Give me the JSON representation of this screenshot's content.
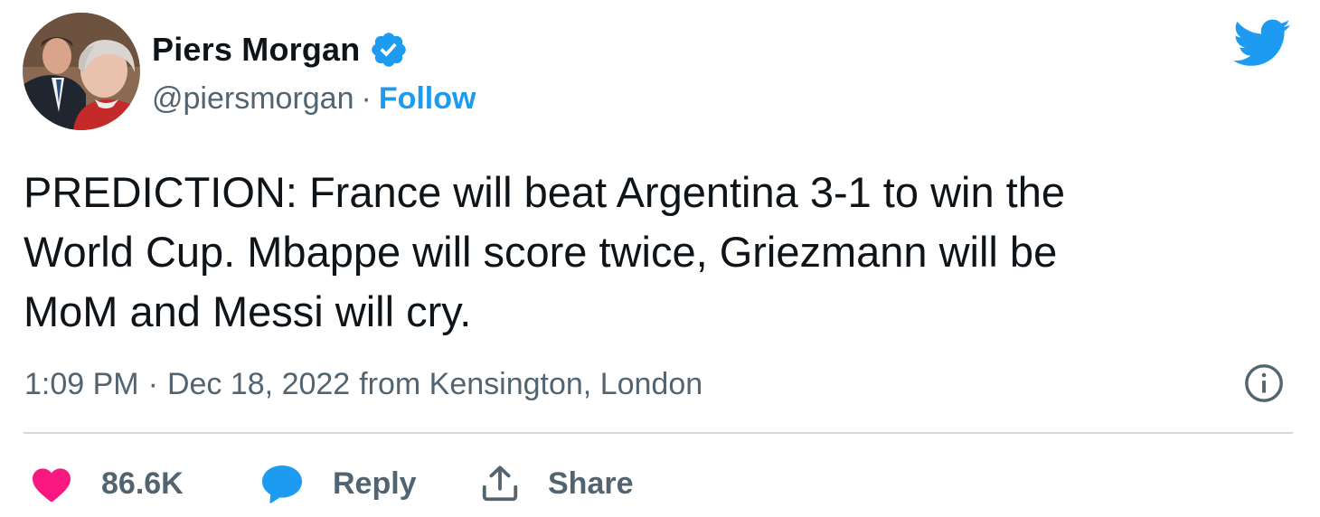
{
  "author": {
    "display_name": "Piers Morgan",
    "handle": "@piersmorgan",
    "separator": "·",
    "follow_label": "Follow",
    "verified": true
  },
  "tweet": {
    "text": "PREDICTION: France will beat Argentina 3-1 to win the\nWorld Cup. Mbappe will score twice, Griezmann will be\nMoM and Messi will cry."
  },
  "meta": {
    "time": "1:09 PM",
    "separator": "·",
    "date": "Dec 18, 2022",
    "location": "from Kensington, London"
  },
  "actions": {
    "likes": "86.6K",
    "reply_label": "Reply",
    "share_label": "Share"
  },
  "icons": {
    "logo": "twitter-bird-icon",
    "verified": "verified-badge-icon",
    "info": "info-icon",
    "like": "heart-icon",
    "reply": "reply-bubble-icon",
    "share": "share-upload-icon"
  },
  "colors": {
    "brand_blue": "#1d9bf0",
    "heart_pink": "#f91880",
    "secondary_text": "#536471",
    "primary_text": "#0f1419",
    "divider": "#cfd9de"
  }
}
